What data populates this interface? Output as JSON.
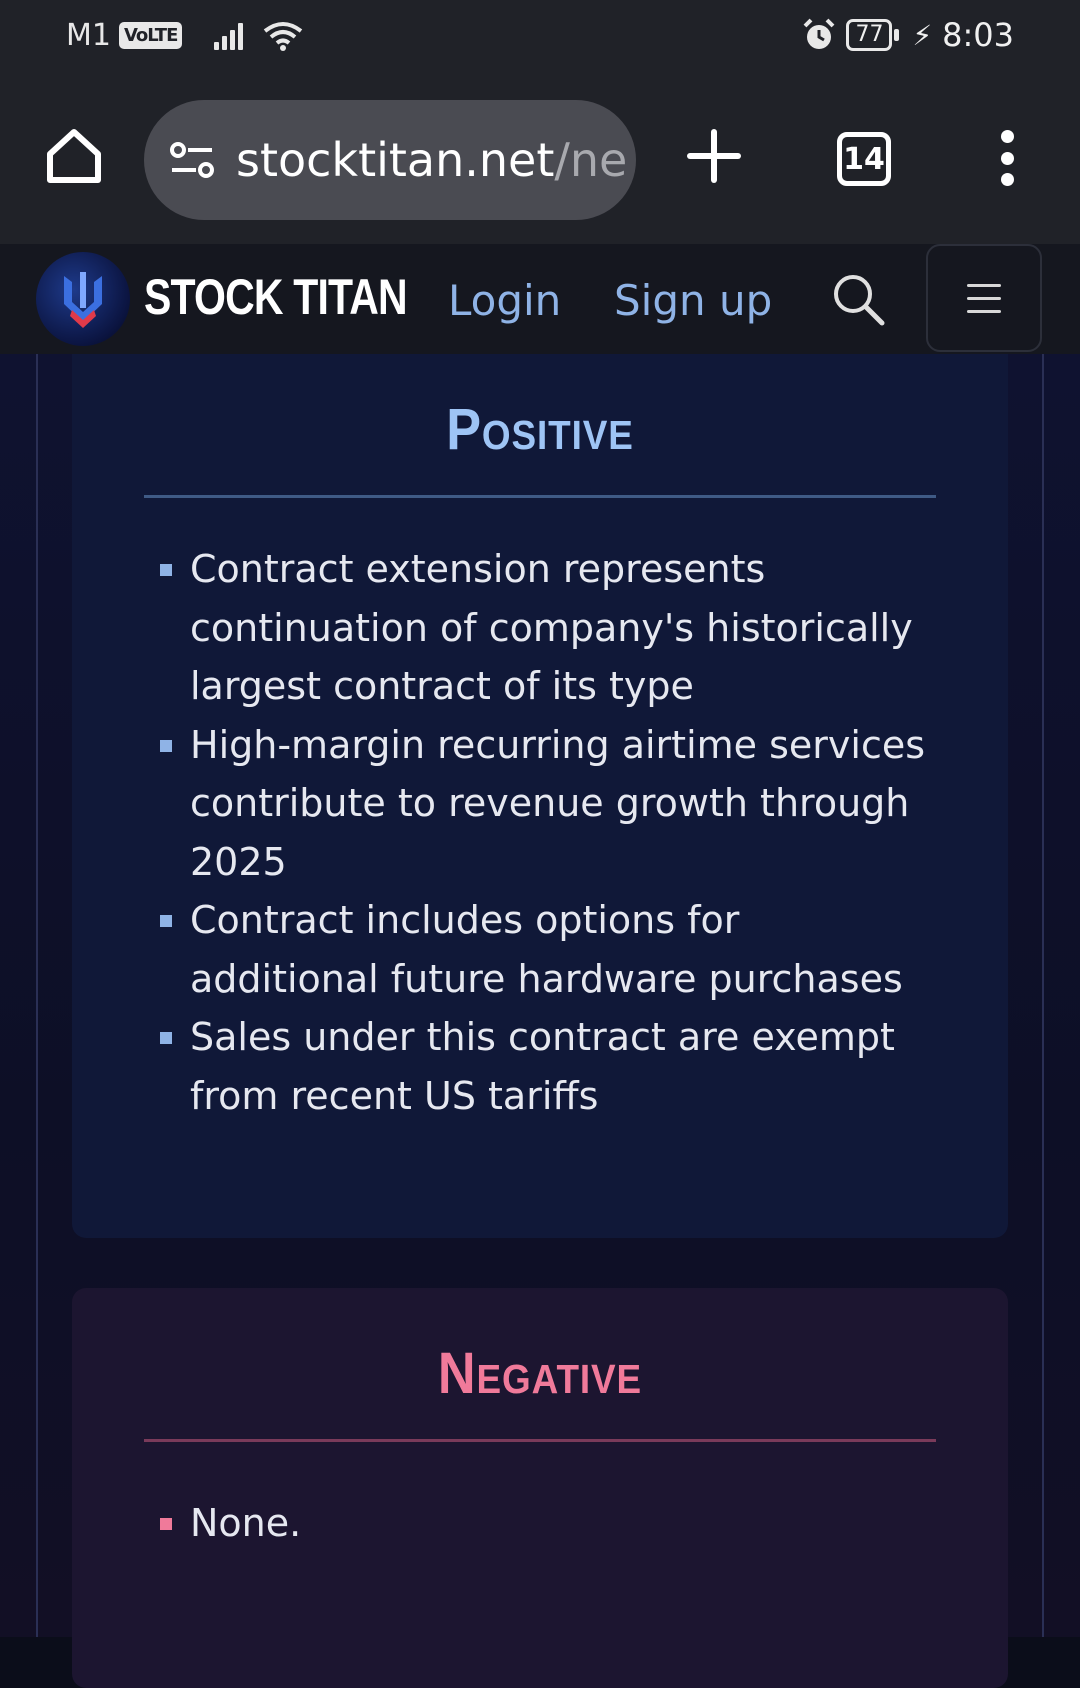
{
  "status_bar": {
    "carrier": "M1",
    "network_badge": "VoLTE",
    "battery": "77",
    "time": "8:03",
    "icons": [
      "signal-icon",
      "wifi-icon",
      "alarm-icon",
      "battery-icon",
      "charging-icon"
    ]
  },
  "browser": {
    "url_domain": "stocktitan.net",
    "url_path": "/ne",
    "tab_count": "14",
    "icons": [
      "home-icon",
      "site-settings-icon",
      "plus-icon",
      "tabs-icon",
      "more-icon"
    ]
  },
  "site_header": {
    "brand": "STOCK TITAN",
    "login": "Login",
    "signup": "Sign up",
    "icons": [
      "logo-icon",
      "search-icon",
      "hamburger-icon"
    ]
  },
  "positive": {
    "title": "Positive",
    "items": [
      "Contract extension represents continuation of company's historically largest contract of its type",
      "High-margin recurring airtime services contribute to revenue growth through 2025",
      "Contract includes options for additional future hardware purchases",
      "Sales under this contract are exempt from recent US tariffs"
    ]
  },
  "negative": {
    "title": "Negative",
    "items": [
      "None."
    ]
  },
  "colors": {
    "positive_accent": "#9ec4f5",
    "negative_accent": "#f07a9a",
    "nav_link": "#8fb3e6",
    "background": "#0d0f26"
  }
}
